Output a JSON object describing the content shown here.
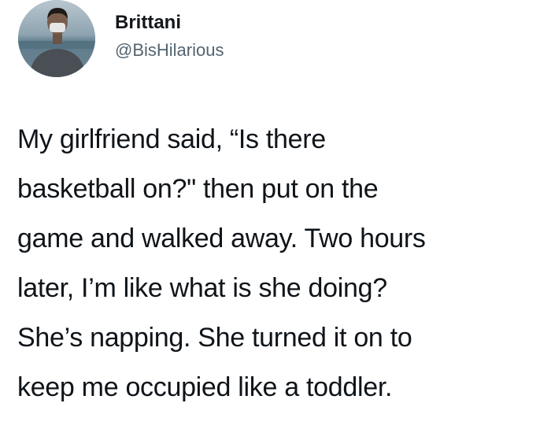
{
  "tweet": {
    "author": {
      "display_name": "Brittani",
      "handle": "@BisHilarious",
      "avatar_description": "profile photo of a person wearing a face mask"
    },
    "text_lines": [
      "My girlfriend said, “Is there",
      "basketball on?\" then put on the",
      "game and walked away. Two hours",
      "later, I’m like what is she doing?",
      "She’s napping. She turned it on to",
      "keep me occupied like a toddler."
    ]
  }
}
